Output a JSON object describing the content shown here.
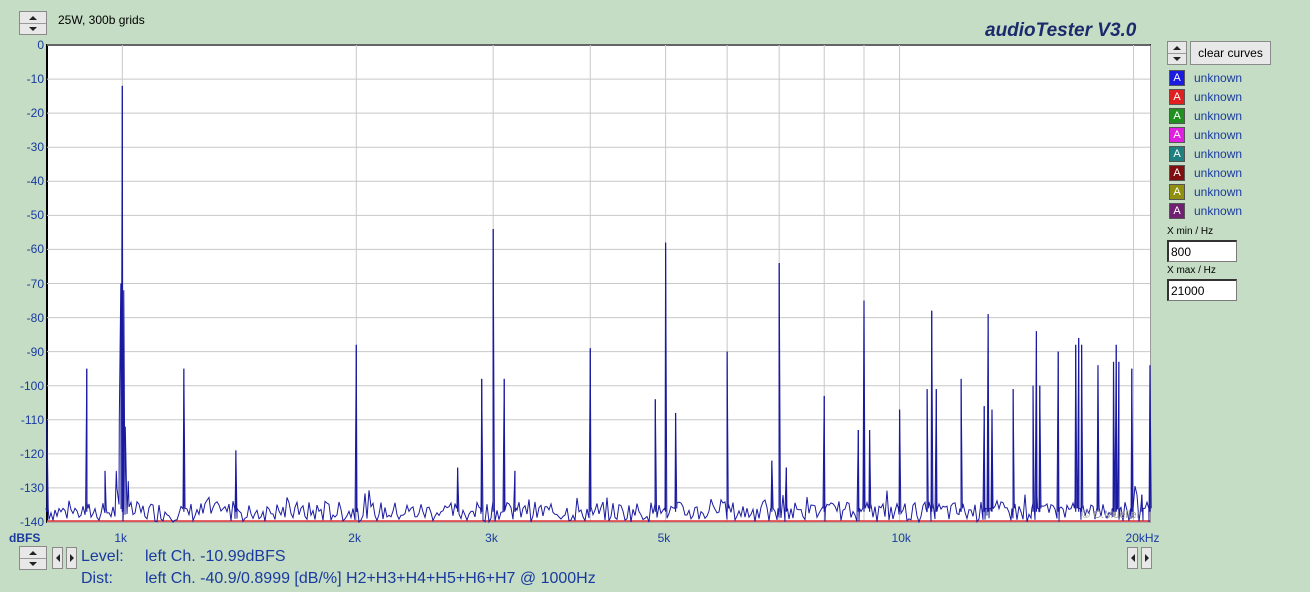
{
  "preset_label": "25W, 300b grids",
  "app_title": "audioTester  V3.0",
  "clear_button": "clear curves",
  "legend": [
    {
      "label": "unknown",
      "color": "#1a1ae0",
      "glyph": "A"
    },
    {
      "label": "unknown",
      "color": "#e02020",
      "glyph": "A"
    },
    {
      "label": "unknown",
      "color": "#209020",
      "glyph": "A"
    },
    {
      "label": "unknown",
      "color": "#e020e0",
      "glyph": "A"
    },
    {
      "label": "unknown",
      "color": "#208080",
      "glyph": "A"
    },
    {
      "label": "unknown",
      "color": "#801010",
      "glyph": "A"
    },
    {
      "label": "unknown",
      "color": "#909010",
      "glyph": "A"
    },
    {
      "label": "unknown",
      "color": "#702070",
      "glyph": "A"
    }
  ],
  "xmin_label": "X min / Hz",
  "xmin_value": "800",
  "xmax_label": "X max / Hz",
  "xmax_value": "21000",
  "copyright": "© C.Mueller",
  "status": {
    "level_key": "Level:",
    "level_value": "left Ch. -10.99dBFS",
    "dist_key": "Dist:",
    "dist_value": "left Ch. -40.9/0.8999 [dB/%] H2+H3+H4+H5+H6+H7 @ 1000Hz"
  },
  "chart_data": {
    "type": "line",
    "xscale": "log",
    "xlim": [
      800,
      21000
    ],
    "ylim": [
      -140,
      0
    ],
    "ylabel": "dBFS",
    "xunit": "kHz",
    "grid": true,
    "y_ticks": [
      "0",
      "-10",
      "-20",
      "-30",
      "-40",
      "-50",
      "-60",
      "-70",
      "-80",
      "-90",
      "-100",
      "-110",
      "-120",
      "-130",
      "-140"
    ],
    "x_ticks": [
      {
        "value": 1000,
        "label": "1k"
      },
      {
        "value": 2000,
        "label": "2k"
      },
      {
        "value": 3000,
        "label": "3k"
      },
      {
        "value": 5000,
        "label": "5k"
      },
      {
        "value": 10000,
        "label": "10k"
      },
      {
        "value": 20000,
        "label": "20kHz"
      }
    ],
    "x_gridlines": [
      1000,
      2000,
      3000,
      4000,
      5000,
      6000,
      7000,
      8000,
      9000,
      10000,
      20000
    ],
    "series": [
      {
        "color": "#1a1aa0",
        "noise_floor": -137,
        "peaks": [
          [
            800,
            -110
          ],
          [
            900,
            -95
          ],
          [
            950,
            -125
          ],
          [
            1000,
            -12
          ],
          [
            1200,
            -95
          ],
          [
            1400,
            -119
          ],
          [
            2000,
            -88
          ],
          [
            2700,
            -124
          ],
          [
            2900,
            -98
          ],
          [
            3000,
            -54
          ],
          [
            3100,
            -98
          ],
          [
            3200,
            -125
          ],
          [
            4000,
            -89
          ],
          [
            4850,
            -104
          ],
          [
            5000,
            -58
          ],
          [
            5150,
            -108
          ],
          [
            6000,
            -90
          ],
          [
            6850,
            -122
          ],
          [
            7000,
            -64
          ],
          [
            7150,
            -124
          ],
          [
            8000,
            -103
          ],
          [
            8850,
            -113
          ],
          [
            9000,
            -75
          ],
          [
            9150,
            -113
          ],
          [
            10000,
            -107
          ],
          [
            10850,
            -101
          ],
          [
            11000,
            -78
          ],
          [
            11150,
            -101
          ],
          [
            12000,
            -98
          ],
          [
            12850,
            -106
          ],
          [
            13000,
            -79
          ],
          [
            13150,
            -107
          ],
          [
            14000,
            -101
          ],
          [
            14850,
            -100
          ],
          [
            15000,
            -84
          ],
          [
            15150,
            -100
          ],
          [
            16000,
            -90
          ],
          [
            16850,
            -88
          ],
          [
            17000,
            -86
          ],
          [
            17150,
            -88
          ],
          [
            18000,
            -94
          ],
          [
            18850,
            -93
          ],
          [
            19000,
            -88
          ],
          [
            19150,
            -93
          ],
          [
            19900,
            -95
          ],
          [
            20500,
            -132
          ],
          [
            21000,
            -94
          ]
        ]
      },
      {
        "color": "#e03030",
        "constant": -140
      }
    ]
  }
}
